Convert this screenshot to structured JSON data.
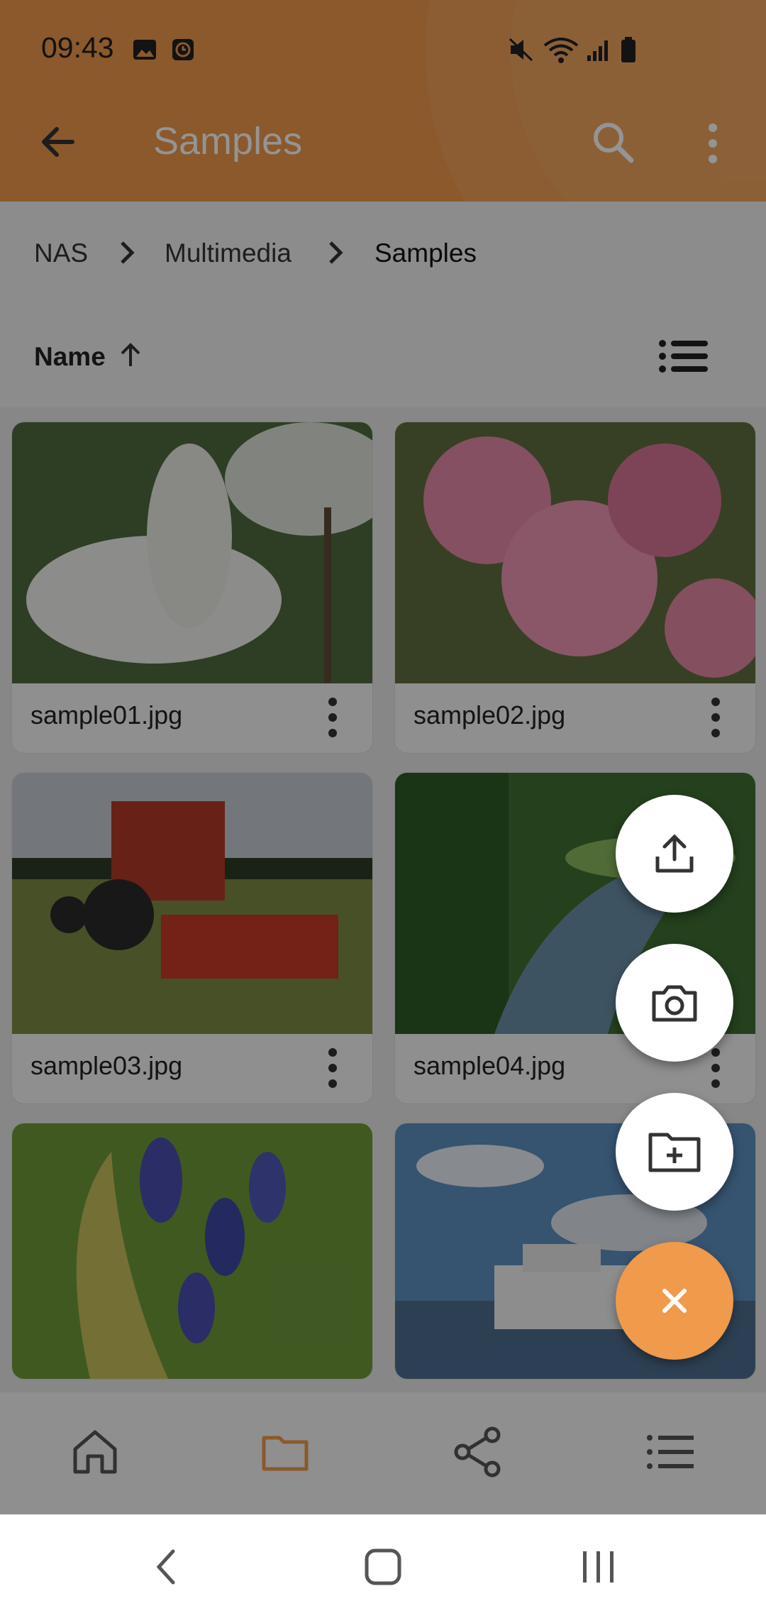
{
  "status_bar": {
    "time": "09:43"
  },
  "header": {
    "title": "Samples"
  },
  "breadcrumb": {
    "items": [
      "NAS",
      "Multimedia",
      "Samples"
    ]
  },
  "sort": {
    "label": "Name"
  },
  "files": [
    {
      "name": "sample01.jpg"
    },
    {
      "name": "sample02.jpg"
    },
    {
      "name": "sample03.jpg"
    },
    {
      "name": "sample04.jpg"
    },
    {
      "name": ""
    },
    {
      "name": ""
    }
  ],
  "fab_menu": [
    "upload-icon",
    "camera-icon",
    "new-folder-icon",
    "close-icon"
  ],
  "bottom_nav": [
    "home-icon",
    "folder-icon",
    "share-icon",
    "list-icon"
  ],
  "colors": {
    "accent": "#f09a4b"
  }
}
